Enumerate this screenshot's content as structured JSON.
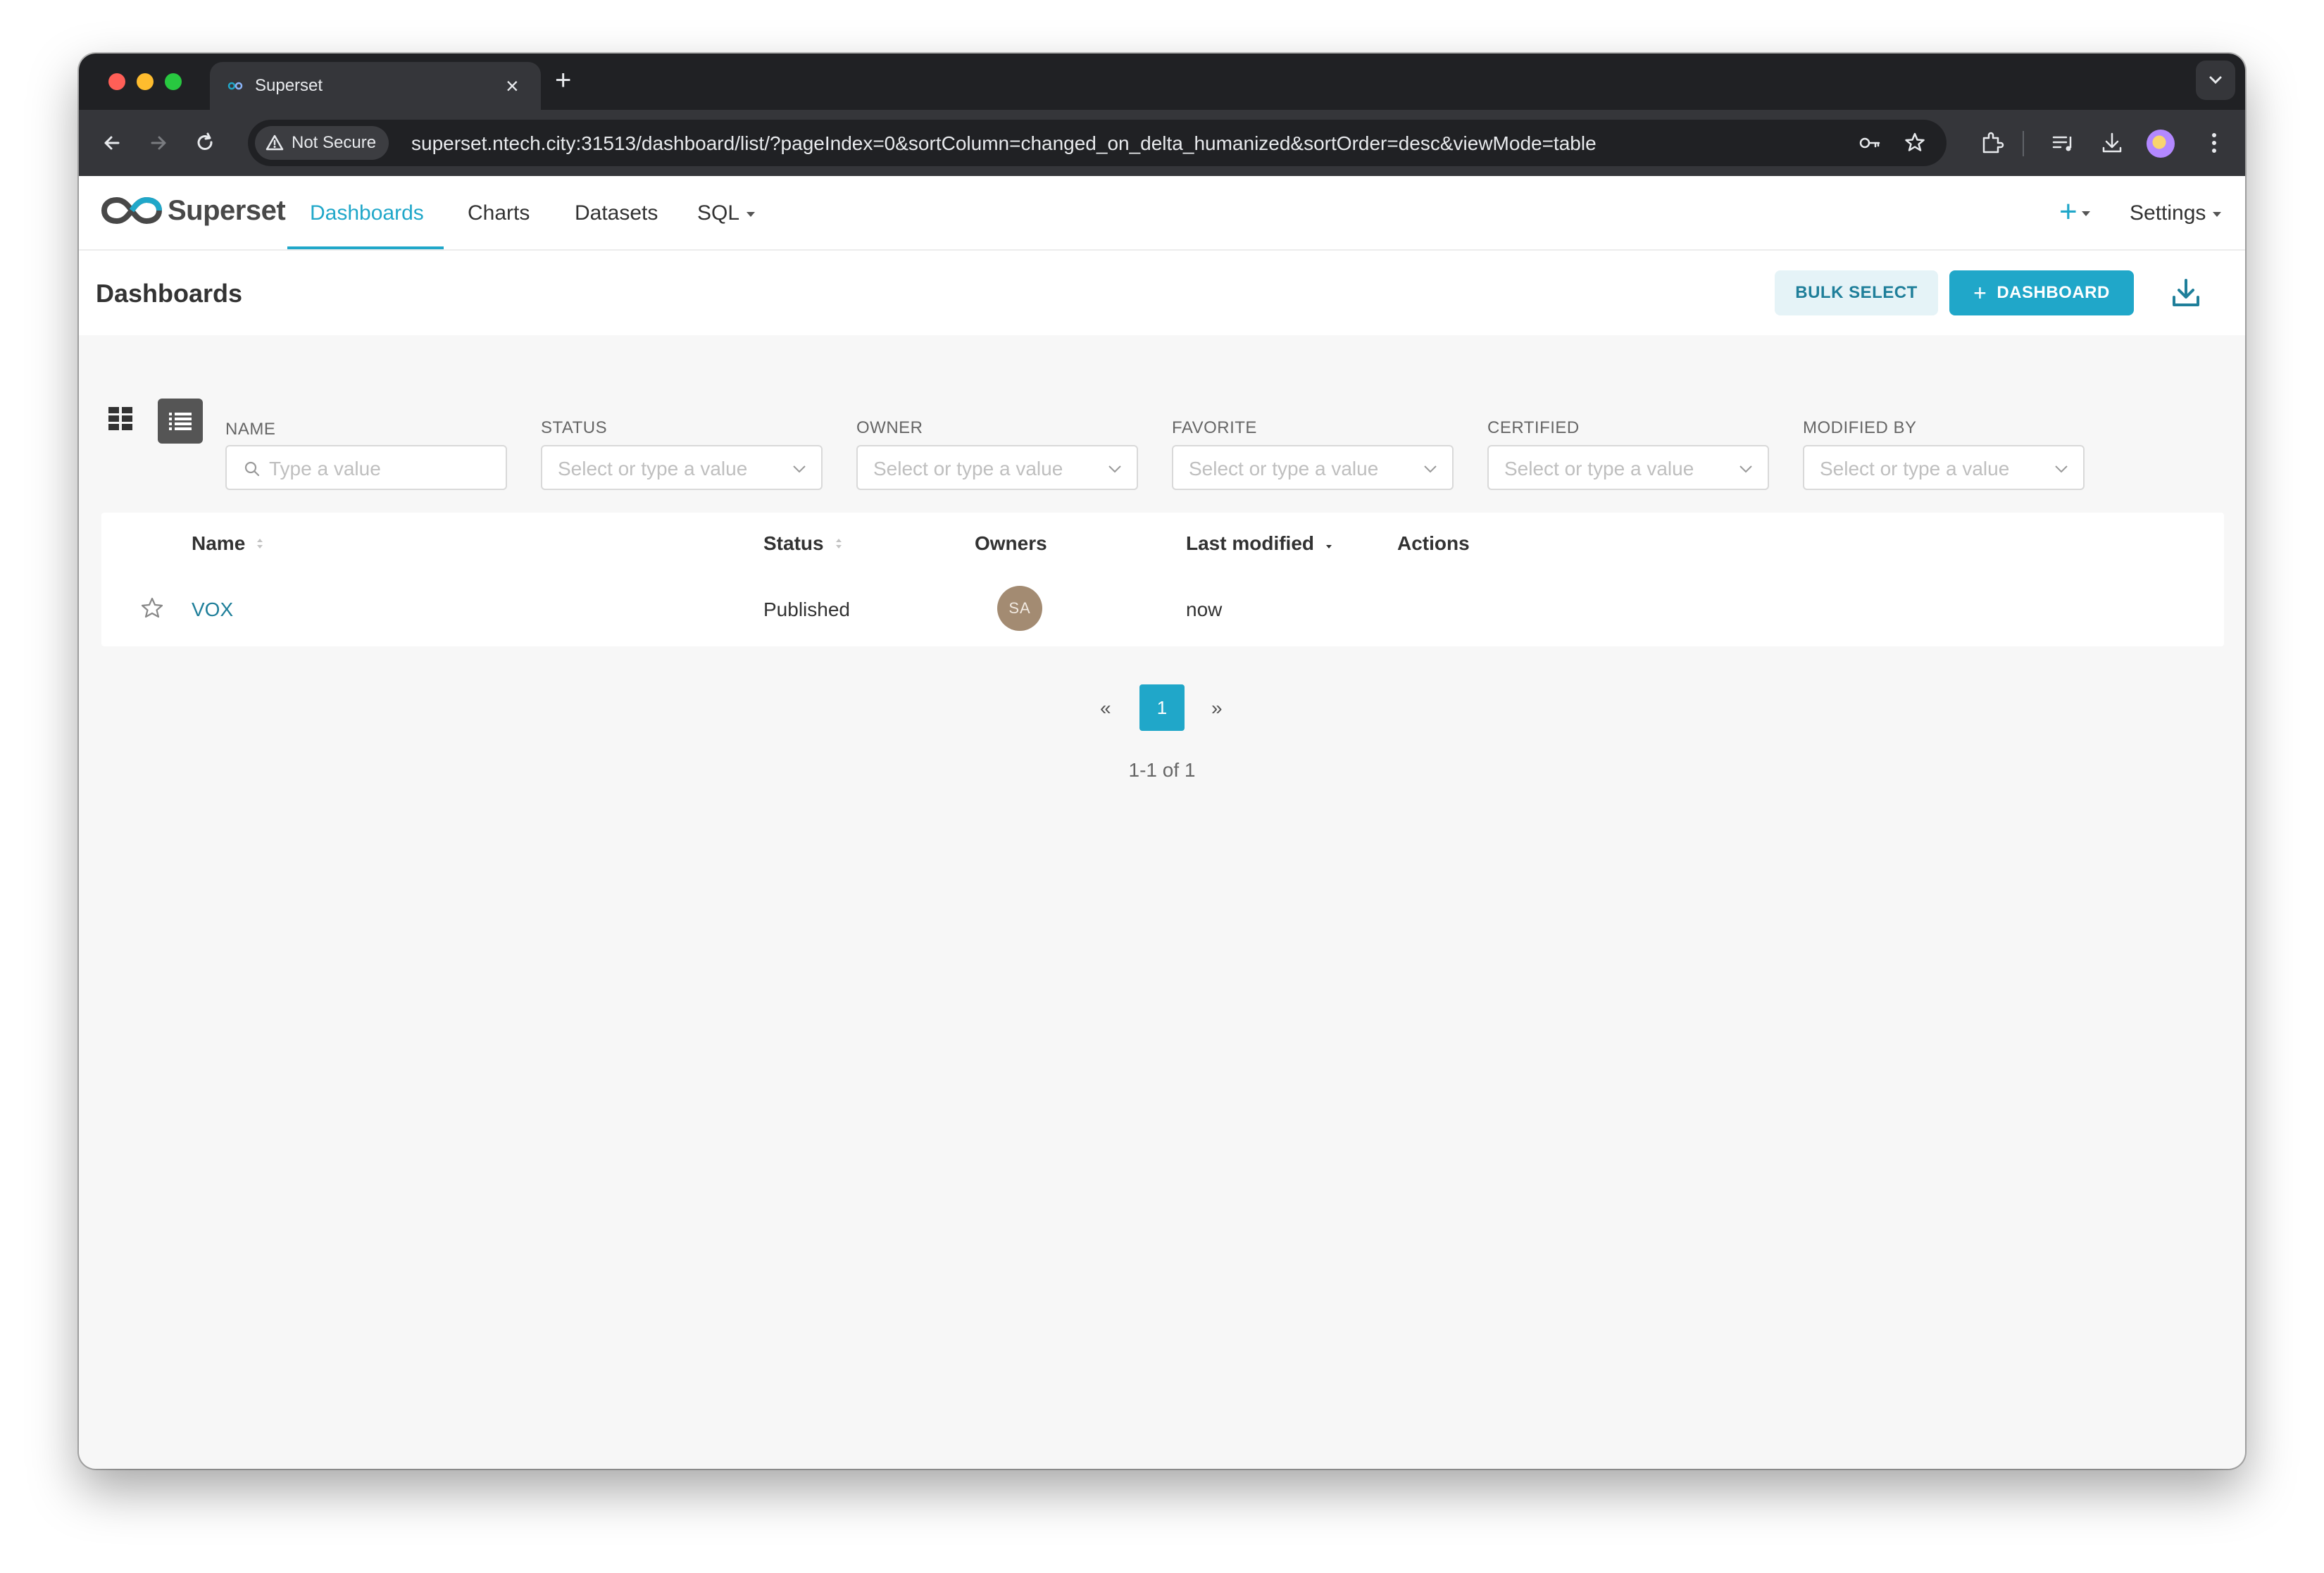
{
  "browser": {
    "tab_title": "Superset",
    "tab_close": "×",
    "new_tab": "+",
    "security_label": "Not Secure",
    "url": "superset.ntech.city:31513/dashboard/list/?pageIndex=0&sortColumn=changed_on_delta_humanized&sortOrder=desc&viewMode=table"
  },
  "app_nav": {
    "logo_text": "Superset",
    "items": [
      {
        "label": "Dashboards",
        "active": true
      },
      {
        "label": "Charts",
        "active": false
      },
      {
        "label": "Datasets",
        "active": false
      },
      {
        "label": "SQL",
        "active": false,
        "dropdown": true
      }
    ],
    "plus_label": "+",
    "settings_label": "Settings"
  },
  "header": {
    "title": "Dashboards",
    "bulk_select_label": "BULK SELECT",
    "dashboard_button_label": "DASHBOARD",
    "dashboard_button_icon": "+"
  },
  "filters": [
    {
      "label": "NAME",
      "placeholder": "Type a value",
      "kind": "search"
    },
    {
      "label": "STATUS",
      "placeholder": "Select or type a value",
      "kind": "select"
    },
    {
      "label": "OWNER",
      "placeholder": "Select or type a value",
      "kind": "select"
    },
    {
      "label": "FAVORITE",
      "placeholder": "Select or type a value",
      "kind": "select"
    },
    {
      "label": "CERTIFIED",
      "placeholder": "Select or type a value",
      "kind": "select"
    },
    {
      "label": "MODIFIED BY",
      "placeholder": "Select or type a value",
      "kind": "select"
    }
  ],
  "table": {
    "columns": [
      "Name",
      "Status",
      "Owners",
      "Last modified",
      "Actions"
    ],
    "rows": [
      {
        "name": "VOX",
        "status": "Published",
        "owner_initials": "SA",
        "last_modified": "now"
      }
    ]
  },
  "pagination": {
    "prev": "«",
    "current_page": "1",
    "next": "»",
    "summary": "1-1 of 1"
  },
  "colors": {
    "accent": "#20a7c9",
    "link": "#1f7f9a",
    "avatar": "#a38b72"
  },
  "icons": [
    "back-icon",
    "forward-icon",
    "reload-icon",
    "warning-icon",
    "key-icon",
    "bookmark-star-icon",
    "extensions-icon",
    "media-icon",
    "download-icon",
    "menu-icon",
    "grid-view-icon",
    "list-view-icon",
    "search-icon",
    "chevron-down-icon",
    "star-icon",
    "sort-icon"
  ]
}
